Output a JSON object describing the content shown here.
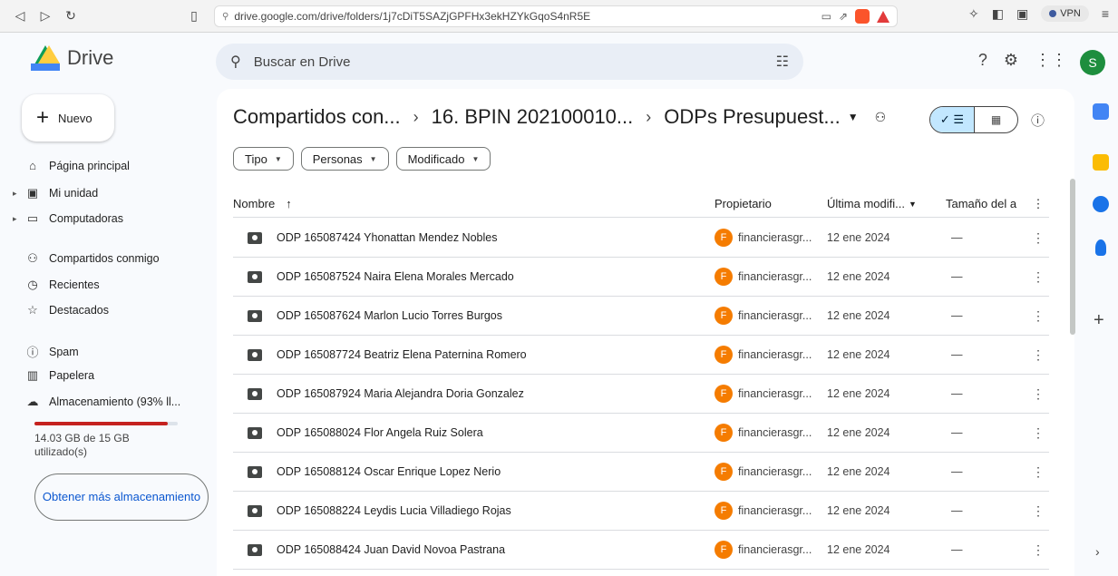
{
  "browser": {
    "url": "drive.google.com/drive/folders/1j7cDiT5SAZjGPFHx3ekHZYkGqoS4nR5E",
    "vpn_label": "VPN"
  },
  "header": {
    "product_name": "Drive",
    "search_placeholder": "Buscar en Drive",
    "avatar_letter": "S"
  },
  "sidebar": {
    "new_label": "Nuevo",
    "items": [
      {
        "label": "Página principal",
        "icon": "home-icon"
      },
      {
        "label": "Mi unidad",
        "icon": "my-drive-icon"
      },
      {
        "label": "Computadoras",
        "icon": "computer-icon"
      },
      {
        "label": "Compartidos conmigo",
        "icon": "shared-icon"
      },
      {
        "label": "Recientes",
        "icon": "clock-icon"
      },
      {
        "label": "Destacados",
        "icon": "star-icon"
      },
      {
        "label": "Spam",
        "icon": "spam-icon"
      },
      {
        "label": "Papelera",
        "icon": "trash-icon"
      },
      {
        "label": "Almacenamiento (93% ll...",
        "icon": "cloud-icon"
      }
    ],
    "storage_used_fraction": 0.93,
    "storage_text": "14.03 GB de 15 GB utilizado(s)",
    "more_storage_label": "Obtener más almacenamiento"
  },
  "breadcrumb": {
    "items": [
      "Compartidos con...",
      "16. BPIN 202100010...",
      "ODPs Presupuest..."
    ]
  },
  "filters": {
    "chips": [
      "Tipo",
      "Personas",
      "Modificado"
    ]
  },
  "table": {
    "headers": {
      "name": "Nombre",
      "owner": "Propietario",
      "modified": "Última modifi...",
      "size": "Tamaño del a"
    },
    "rows": [
      {
        "name": "ODP 165087424 Yhonattan Mendez Nobles",
        "owner": "financierasgr...",
        "owner_initial": "F",
        "modified": "12 ene 2024",
        "size": "—"
      },
      {
        "name": "ODP 165087524 Naira Elena Morales Mercado",
        "owner": "financierasgr...",
        "owner_initial": "F",
        "modified": "12 ene 2024",
        "size": "—"
      },
      {
        "name": "ODP 165087624 Marlon Lucio Torres Burgos",
        "owner": "financierasgr...",
        "owner_initial": "F",
        "modified": "12 ene 2024",
        "size": "—"
      },
      {
        "name": "ODP 165087724 Beatriz Elena Paternina Romero",
        "owner": "financierasgr...",
        "owner_initial": "F",
        "modified": "12 ene 2024",
        "size": "—"
      },
      {
        "name": "ODP 165087924 Maria Alejandra Doria Gonzalez",
        "owner": "financierasgr...",
        "owner_initial": "F",
        "modified": "12 ene 2024",
        "size": "—"
      },
      {
        "name": "ODP 165088024 Flor Angela Ruiz Solera",
        "owner": "financierasgr...",
        "owner_initial": "F",
        "modified": "12 ene 2024",
        "size": "—"
      },
      {
        "name": "ODP 165088124 Oscar Enrique Lopez Nerio",
        "owner": "financierasgr...",
        "owner_initial": "F",
        "modified": "12 ene 2024",
        "size": "—"
      },
      {
        "name": "ODP 165088224 Leydis Lucia Villadiego Rojas",
        "owner": "financierasgr...",
        "owner_initial": "F",
        "modified": "12 ene 2024",
        "size": "—"
      },
      {
        "name": "ODP 165088424 Juan David Novoa Pastrana",
        "owner": "financierasgr...",
        "owner_initial": "F",
        "modified": "12 ene 2024",
        "size": "—"
      }
    ]
  },
  "colors": {
    "accent": "#0b57d0",
    "selected_view": "#c2e7ff",
    "owner_avatar": "#f57c00",
    "storage_warning": "#c5221f"
  }
}
